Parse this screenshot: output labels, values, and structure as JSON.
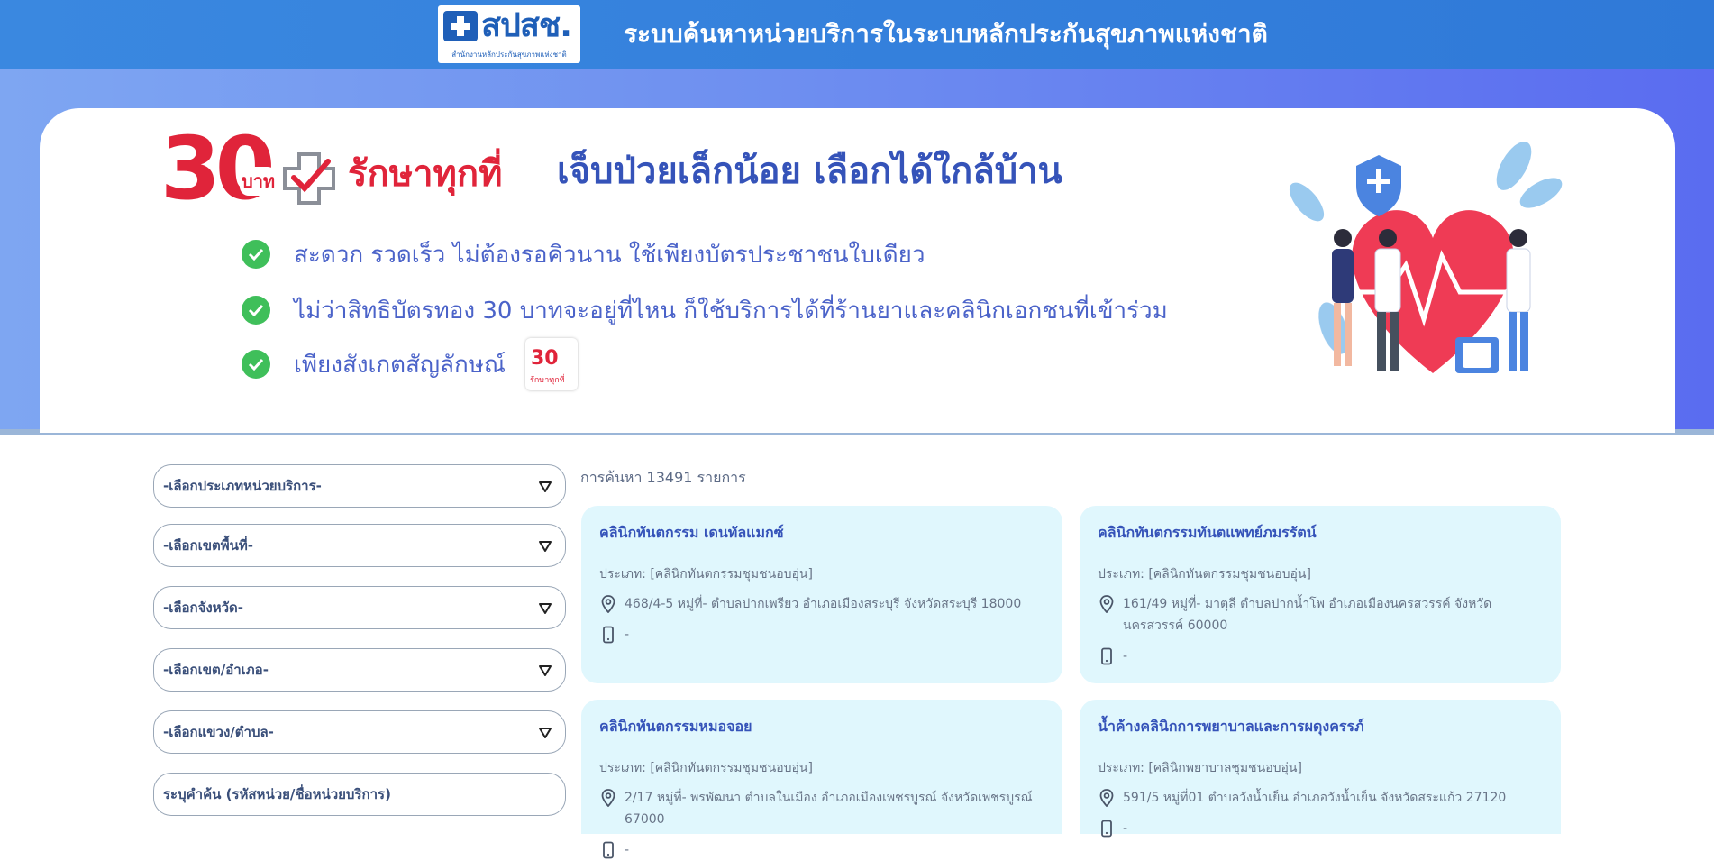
{
  "header": {
    "logo_text": "สปสช.",
    "logo_subtitle": "สำนักงานหลักประกันสุขภาพแห่งชาติ",
    "title": "ระบบค้นหาหน่วยบริการในระบบหลักประกันสุขภาพแห่งชาติ"
  },
  "hero": {
    "brand_number": "30",
    "brand_unit": "บาท",
    "brand_slogan": "รักษาทุกที่",
    "headline": "เจ็บป่วยเล็กน้อย เลือกได้ใกล้บ้าน",
    "bullets": [
      "สะดวก รวดเร็ว ไม่ต้องรอคิวนาน ใช้เพียงบัตรประชาชนใบเดียว",
      "ไม่ว่าสิทธิบัตรทอง 30 บาทจะอยู่ที่ไหน ก็ใช้บริการได้ที่ร้านยาและคลินิกเอกชนที่เข้าร่วม",
      "เพียงสังเกตสัญลักษณ์"
    ],
    "mini_logo_number": "30",
    "mini_logo_text": "รักษาทุกที่"
  },
  "filters": {
    "service_type": "-เลือกประเภทหน่วยบริการ-",
    "zone": "-เลือกเขตพื้นที่-",
    "province": "-เลือกจังหวัด-",
    "district": "-เลือกเขต/อำเภอ-",
    "subdistrict": "-เลือกแขวง/ตำบล-",
    "search_placeholder": "ระบุคำค้น (รหัสหน่วย/ชื่อหน่วยบริการ)"
  },
  "results": {
    "count_text": "การค้นหา 13491 รายการ",
    "cards": [
      {
        "name": "คลินิกทันตกรรม เดนทัลแมกซ์",
        "type": "ประเภท: [คลินิกทันตกรรมชุมชนอบอุ่น]",
        "address": "468/4-5 หมู่ที่- ตำบลปากเพรียว อำเภอเมืองสระบุรี จังหวัดสระบุรี 18000",
        "phone": "-"
      },
      {
        "name": "คลินิกทันตกรรมทันตแพทย์ภมรรัตน์",
        "type": "ประเภท: [คลินิกทันตกรรมชุมชนอบอุ่น]",
        "address": "161/49 หมู่ที่- มาตุลี ตำบลปากน้ำโพ อำเภอเมืองนครสวรรค์ จังหวัดนครสวรรค์ 60000",
        "phone": "-"
      },
      {
        "name": "คลินิกทันตกรรมหมอจอย",
        "type": "ประเภท: [คลินิกทันตกรรมชุมชนอบอุ่น]",
        "address": "2/17 หมู่ที่- พรพัฒนา ตำบลในเมือง อำเภอเมืองเพชรบูรณ์ จังหวัดเพชรบูรณ์ 67000",
        "phone": "-"
      },
      {
        "name": "น้ำค้างคลินิกการพยาบาลและการผดุงครรภ์",
        "type": "ประเภท: [คลินิกพยาบาลชุมชนอบอุ่น]",
        "address": "591/5 หมู่ที่01 ตำบลวังน้ำเย็น อำเภอวังน้ำเย็น จังหวัดสระแก้ว 27120",
        "phone": "-"
      }
    ]
  },
  "colors": {
    "header_blue": "#2f79d8",
    "brand_red": "#e0243a",
    "card_bg": "#e0f7fd",
    "accent_blue": "#3553b9",
    "check_green": "#3fbf5a"
  },
  "icons": {
    "caret": "caret-down-icon",
    "location": "map-pin-icon",
    "phone": "mobile-phone-icon",
    "check": "check-circle-icon"
  }
}
